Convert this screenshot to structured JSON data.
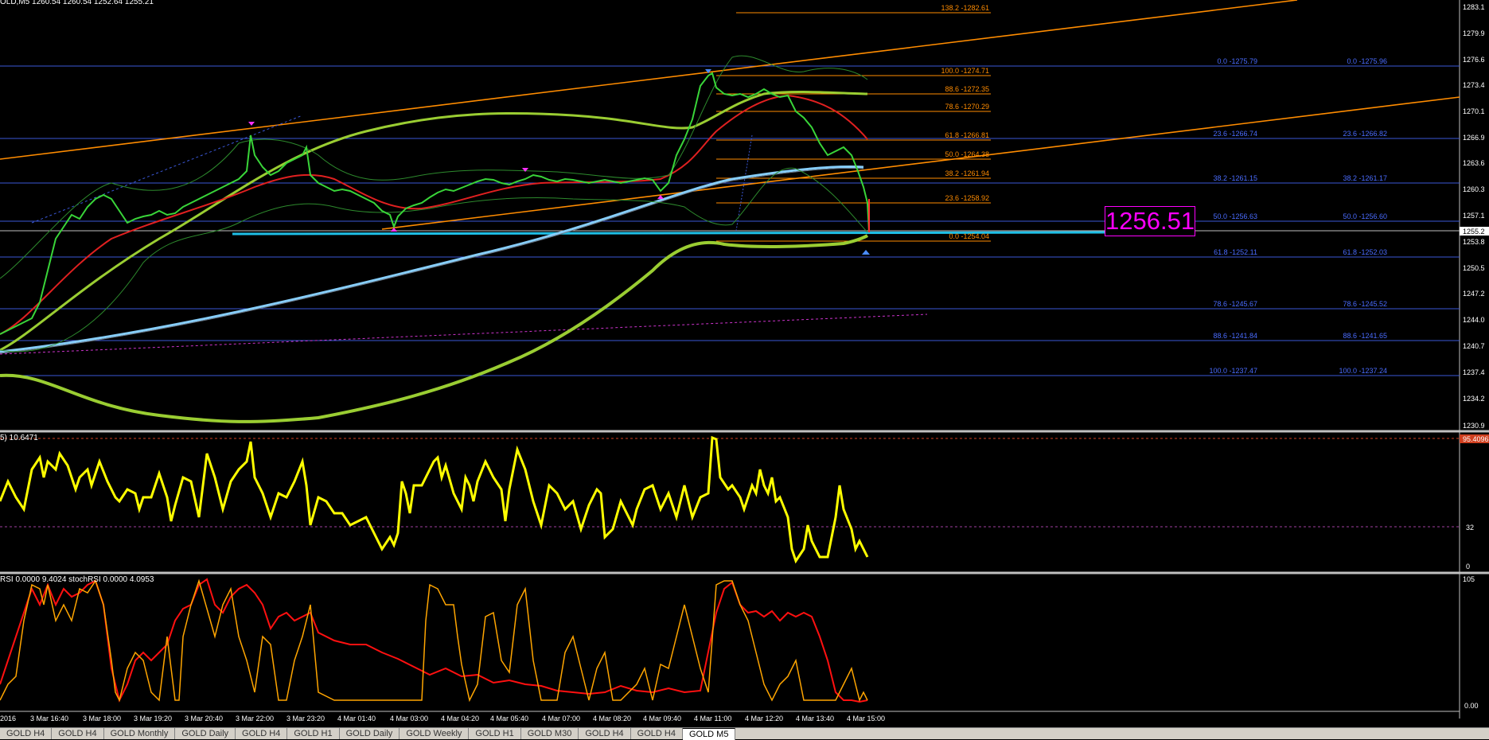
{
  "header": {
    "main": "OLD,M5  1260.54 1260.54 1252.64 1255.21",
    "stoch": "5) 10.6471",
    "rsi": "RSI 0.0000 9.4024  stochRSI 0.0000 4.0953"
  },
  "current_price_label": "1256.51",
  "price_axis": {
    "labels": [
      "1283.1",
      "1279.9",
      "1276.6",
      "1273.4",
      "1270.1",
      "1266.9",
      "1263.6",
      "1260.3",
      "1257.1",
      "1253.8",
      "1250.5",
      "1247.2",
      "1244.0",
      "1240.7",
      "1237.4",
      "1234.2",
      "1230.9"
    ],
    "current_tag": "1255.2",
    "stoch_labels": [
      "32",
      "0"
    ],
    "stoch_marker": "95.4096",
    "rsi_labels": [
      "105",
      "0.00"
    ]
  },
  "time_axis": [
    "2016",
    "3 Mar 16:40",
    "3 Mar 18:00",
    "3 Mar 19:20",
    "3 Mar 20:40",
    "3 Mar 22:00",
    "3 Mar 23:20",
    "4 Mar 01:40",
    "4 Mar 03:00",
    "4 Mar 04:20",
    "4 Mar 05:40",
    "4 Mar 07:00",
    "4 Mar 08:20",
    "4 Mar 09:40",
    "4 Mar 11:00",
    "4 Mar 12:20",
    "4 Mar 13:40",
    "4 Mar 15:00"
  ],
  "fib_orange": [
    "138.2 -1282.61",
    "100.0 -1274.71",
    "88.6 -1272.35",
    "78.6 -1270.29",
    "61.8 -1266.81",
    "50.0 -1264.38",
    "38.2 -1261.94",
    "23.6 -1258.92",
    "0.0 -1254.04"
  ],
  "fib_blue_left": [
    "0.0 -1275.79",
    "23.6 -1266.74",
    "38.2 -1261.15",
    "50.0 -1256.63",
    "61.8 -1252.11",
    "78.6 -1245.67",
    "88.6 -1241.84",
    "100.0 -1237.47"
  ],
  "fib_blue_right": [
    "0.0 -1275.96",
    "23.6 -1266.82",
    "38.2 -1261.17",
    "50.0 -1256.60",
    "61.8 -1252.03",
    "78.6 -1245.52",
    "88.6 -1241.65",
    "100.0 -1237.24"
  ],
  "tabs": [
    "GOLD H4",
    "GOLD H4",
    "GOLD Monthly",
    "GOLD Daily",
    "GOLD H4",
    "GOLD H1",
    "GOLD Daily",
    "GOLD Weekly",
    "GOLD H1",
    "GOLD M30",
    "GOLD H4",
    "GOLD H4",
    "GOLD M5"
  ],
  "active_tab_index": 12,
  "colors": {
    "fib_orange": "#ff8c00",
    "fib_blue": "#4169e1",
    "stoch": "#ffff00",
    "rsi_red": "#ff0000",
    "rsi_orange": "#ffa500",
    "ma_green": "#9acd32",
    "ma_blue": "#87cefa"
  }
}
